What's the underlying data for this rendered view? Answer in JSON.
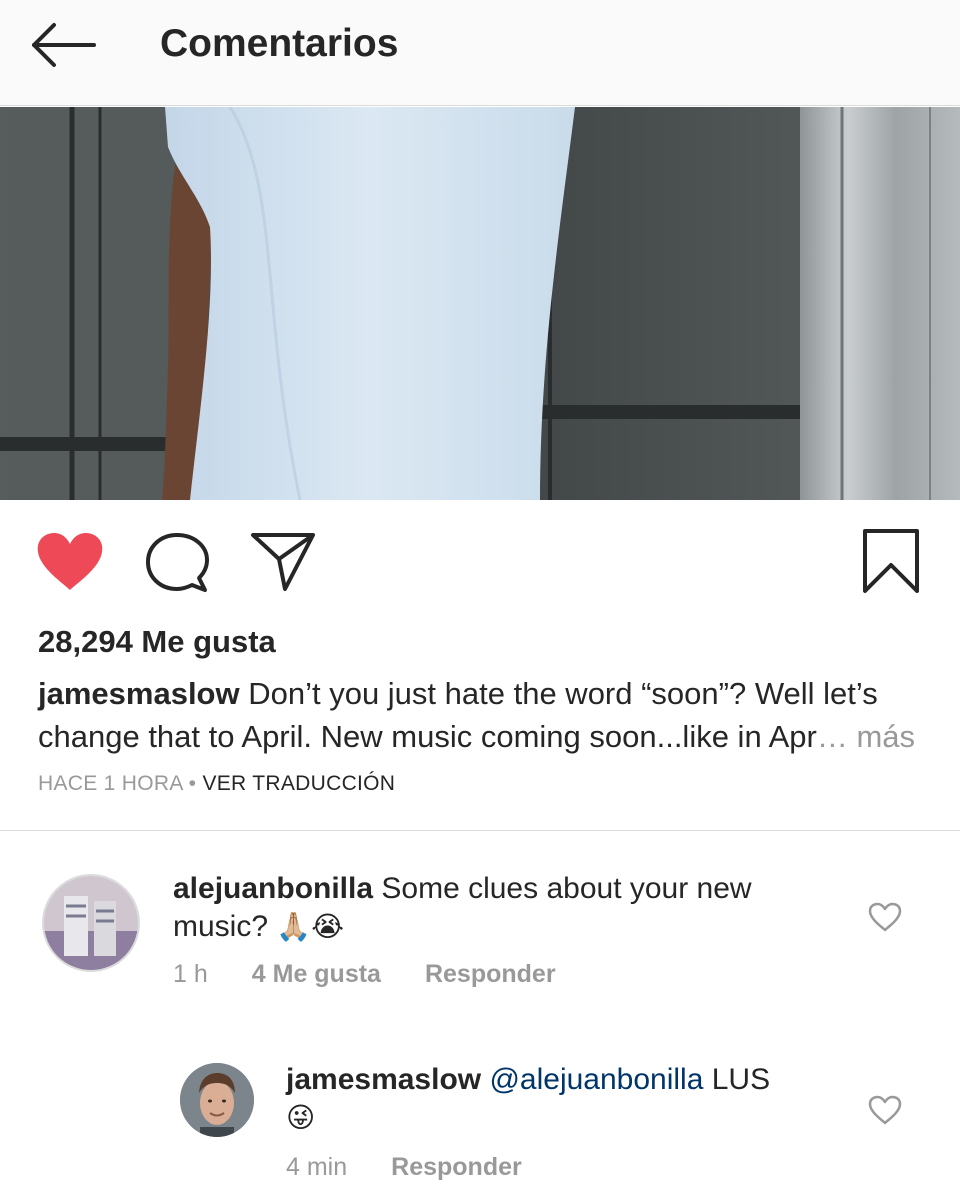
{
  "header": {
    "title": "Comentarios",
    "back_icon": "arrow-left-icon"
  },
  "post": {
    "likes": "28,294 Me gusta",
    "caption_user": "jamesmaslow",
    "caption_text": " Don’t you just hate the word “soon”? Well let’s change that to April. New music coming soon...like in Apr",
    "caption_more": "… más",
    "time": "HACE 1 HORA",
    "separator": " • ",
    "translate": "VER TRADUCCIÓN",
    "liked": true,
    "colors": {
      "like_red": "#ed4956",
      "text": "#262626",
      "muted": "#999999"
    }
  },
  "comments": [
    {
      "user": "alejuanbonilla",
      "text": " Some clues about your new music? ",
      "emoji": "🙏🏼😭",
      "time": "1 h",
      "likes": "4 Me gusta",
      "reply": "Responder"
    },
    {
      "user": "jamesmaslow",
      "mention": "@alejuanbonilla",
      "text": " LUS",
      "emoji": "😜",
      "time": "4 min",
      "reply": "Responder"
    }
  ]
}
